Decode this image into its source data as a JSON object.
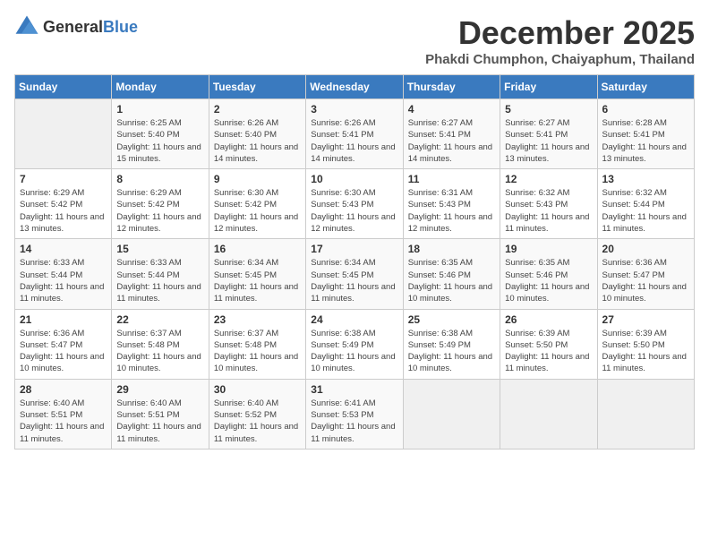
{
  "logo": {
    "general": "General",
    "blue": "Blue"
  },
  "title": {
    "month": "December 2025",
    "location": "Phakdi Chumphon, Chaiyaphum, Thailand"
  },
  "calendar": {
    "headers": [
      "Sunday",
      "Monday",
      "Tuesday",
      "Wednesday",
      "Thursday",
      "Friday",
      "Saturday"
    ],
    "weeks": [
      [
        {
          "day": "",
          "sunrise": "",
          "sunset": "",
          "daylight": "",
          "empty": true
        },
        {
          "day": "1",
          "sunrise": "Sunrise: 6:25 AM",
          "sunset": "Sunset: 5:40 PM",
          "daylight": "Daylight: 11 hours and 15 minutes."
        },
        {
          "day": "2",
          "sunrise": "Sunrise: 6:26 AM",
          "sunset": "Sunset: 5:40 PM",
          "daylight": "Daylight: 11 hours and 14 minutes."
        },
        {
          "day": "3",
          "sunrise": "Sunrise: 6:26 AM",
          "sunset": "Sunset: 5:41 PM",
          "daylight": "Daylight: 11 hours and 14 minutes."
        },
        {
          "day": "4",
          "sunrise": "Sunrise: 6:27 AM",
          "sunset": "Sunset: 5:41 PM",
          "daylight": "Daylight: 11 hours and 14 minutes."
        },
        {
          "day": "5",
          "sunrise": "Sunrise: 6:27 AM",
          "sunset": "Sunset: 5:41 PM",
          "daylight": "Daylight: 11 hours and 13 minutes."
        },
        {
          "day": "6",
          "sunrise": "Sunrise: 6:28 AM",
          "sunset": "Sunset: 5:41 PM",
          "daylight": "Daylight: 11 hours and 13 minutes."
        }
      ],
      [
        {
          "day": "7",
          "sunrise": "Sunrise: 6:29 AM",
          "sunset": "Sunset: 5:42 PM",
          "daylight": "Daylight: 11 hours and 13 minutes."
        },
        {
          "day": "8",
          "sunrise": "Sunrise: 6:29 AM",
          "sunset": "Sunset: 5:42 PM",
          "daylight": "Daylight: 11 hours and 12 minutes."
        },
        {
          "day": "9",
          "sunrise": "Sunrise: 6:30 AM",
          "sunset": "Sunset: 5:42 PM",
          "daylight": "Daylight: 11 hours and 12 minutes."
        },
        {
          "day": "10",
          "sunrise": "Sunrise: 6:30 AM",
          "sunset": "Sunset: 5:43 PM",
          "daylight": "Daylight: 11 hours and 12 minutes."
        },
        {
          "day": "11",
          "sunrise": "Sunrise: 6:31 AM",
          "sunset": "Sunset: 5:43 PM",
          "daylight": "Daylight: 11 hours and 12 minutes."
        },
        {
          "day": "12",
          "sunrise": "Sunrise: 6:32 AM",
          "sunset": "Sunset: 5:43 PM",
          "daylight": "Daylight: 11 hours and 11 minutes."
        },
        {
          "day": "13",
          "sunrise": "Sunrise: 6:32 AM",
          "sunset": "Sunset: 5:44 PM",
          "daylight": "Daylight: 11 hours and 11 minutes."
        }
      ],
      [
        {
          "day": "14",
          "sunrise": "Sunrise: 6:33 AM",
          "sunset": "Sunset: 5:44 PM",
          "daylight": "Daylight: 11 hours and 11 minutes."
        },
        {
          "day": "15",
          "sunrise": "Sunrise: 6:33 AM",
          "sunset": "Sunset: 5:44 PM",
          "daylight": "Daylight: 11 hours and 11 minutes."
        },
        {
          "day": "16",
          "sunrise": "Sunrise: 6:34 AM",
          "sunset": "Sunset: 5:45 PM",
          "daylight": "Daylight: 11 hours and 11 minutes."
        },
        {
          "day": "17",
          "sunrise": "Sunrise: 6:34 AM",
          "sunset": "Sunset: 5:45 PM",
          "daylight": "Daylight: 11 hours and 11 minutes."
        },
        {
          "day": "18",
          "sunrise": "Sunrise: 6:35 AM",
          "sunset": "Sunset: 5:46 PM",
          "daylight": "Daylight: 11 hours and 10 minutes."
        },
        {
          "day": "19",
          "sunrise": "Sunrise: 6:35 AM",
          "sunset": "Sunset: 5:46 PM",
          "daylight": "Daylight: 11 hours and 10 minutes."
        },
        {
          "day": "20",
          "sunrise": "Sunrise: 6:36 AM",
          "sunset": "Sunset: 5:47 PM",
          "daylight": "Daylight: 11 hours and 10 minutes."
        }
      ],
      [
        {
          "day": "21",
          "sunrise": "Sunrise: 6:36 AM",
          "sunset": "Sunset: 5:47 PM",
          "daylight": "Daylight: 11 hours and 10 minutes."
        },
        {
          "day": "22",
          "sunrise": "Sunrise: 6:37 AM",
          "sunset": "Sunset: 5:48 PM",
          "daylight": "Daylight: 11 hours and 10 minutes."
        },
        {
          "day": "23",
          "sunrise": "Sunrise: 6:37 AM",
          "sunset": "Sunset: 5:48 PM",
          "daylight": "Daylight: 11 hours and 10 minutes."
        },
        {
          "day": "24",
          "sunrise": "Sunrise: 6:38 AM",
          "sunset": "Sunset: 5:49 PM",
          "daylight": "Daylight: 11 hours and 10 minutes."
        },
        {
          "day": "25",
          "sunrise": "Sunrise: 6:38 AM",
          "sunset": "Sunset: 5:49 PM",
          "daylight": "Daylight: 11 hours and 10 minutes."
        },
        {
          "day": "26",
          "sunrise": "Sunrise: 6:39 AM",
          "sunset": "Sunset: 5:50 PM",
          "daylight": "Daylight: 11 hours and 11 minutes."
        },
        {
          "day": "27",
          "sunrise": "Sunrise: 6:39 AM",
          "sunset": "Sunset: 5:50 PM",
          "daylight": "Daylight: 11 hours and 11 minutes."
        }
      ],
      [
        {
          "day": "28",
          "sunrise": "Sunrise: 6:40 AM",
          "sunset": "Sunset: 5:51 PM",
          "daylight": "Daylight: 11 hours and 11 minutes."
        },
        {
          "day": "29",
          "sunrise": "Sunrise: 6:40 AM",
          "sunset": "Sunset: 5:51 PM",
          "daylight": "Daylight: 11 hours and 11 minutes."
        },
        {
          "day": "30",
          "sunrise": "Sunrise: 6:40 AM",
          "sunset": "Sunset: 5:52 PM",
          "daylight": "Daylight: 11 hours and 11 minutes."
        },
        {
          "day": "31",
          "sunrise": "Sunrise: 6:41 AM",
          "sunset": "Sunset: 5:53 PM",
          "daylight": "Daylight: 11 hours and 11 minutes."
        },
        {
          "day": "",
          "sunrise": "",
          "sunset": "",
          "daylight": "",
          "empty": true
        },
        {
          "day": "",
          "sunrise": "",
          "sunset": "",
          "daylight": "",
          "empty": true
        },
        {
          "day": "",
          "sunrise": "",
          "sunset": "",
          "daylight": "",
          "empty": true
        }
      ]
    ]
  }
}
